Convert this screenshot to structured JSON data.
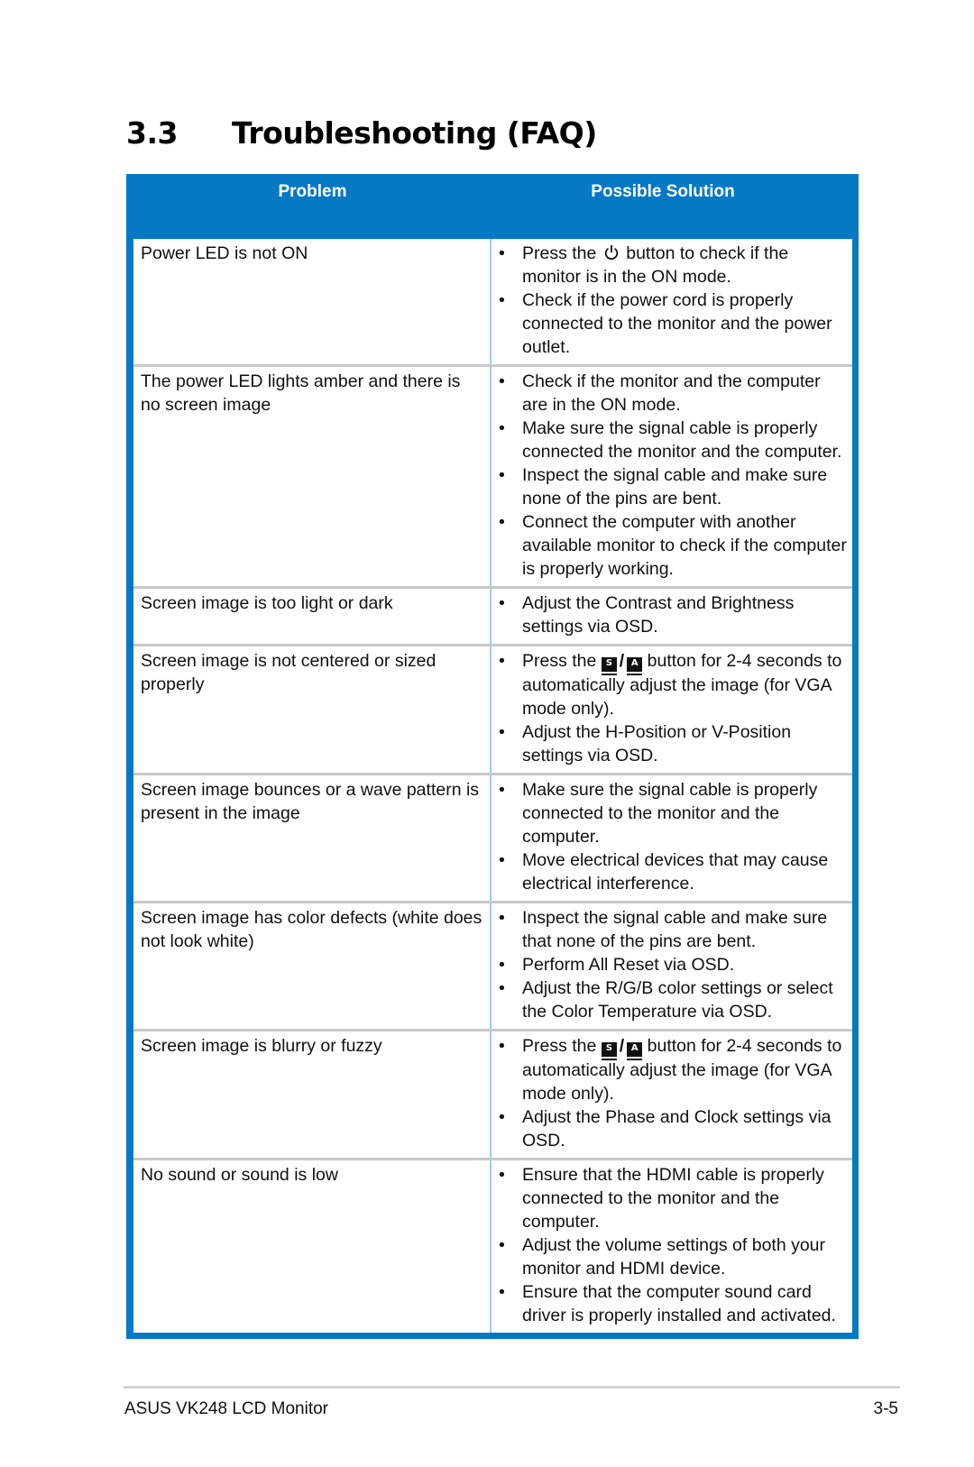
{
  "page": {
    "section_number": "3.3",
    "title": "Troubleshooting (FAQ)",
    "table": {
      "headers": {
        "problem": "Problem",
        "solution": "Possible Solution"
      },
      "header_color": "#0779c4",
      "rows": [
        {
          "problem": "Power  LED is not ON",
          "solutions": [
            {
              "before": "Press the",
              "icon": "power-icon",
              "after": "button to check if the monitor is in the ON mode."
            },
            {
              "before": "Check if the power cord is properly connected to the monitor and the power outlet."
            }
          ]
        },
        {
          "problem": "The power LED lights amber and there is no screen image",
          "solutions": [
            {
              "before": "Check if the monitor and the computer are in the ON mode."
            },
            {
              "before": "Make sure the signal cable is properly connected the monitor and the computer."
            },
            {
              "before": "Inspect the signal cable and make sure none of the pins are bent."
            },
            {
              "before": "Connect the computer with another available monitor to check if the computer is properly working."
            }
          ]
        },
        {
          "problem": "Screen image is too light or dark",
          "solutions": [
            {
              "before": "Adjust the Contrast and Brightness settings via OSD."
            }
          ]
        },
        {
          "problem": "Screen image is not centered or sized properly",
          "solutions": [
            {
              "before": "Press the",
              "icon": "splendid-auto-key-icon",
              "key1": "S",
              "key_sep": "/",
              "key2": "A",
              "after": "button for 2-4 seconds to automatically adjust the image (for VGA mode only)."
            },
            {
              "before": "Adjust the H-Position or V-Position settings via OSD."
            }
          ]
        },
        {
          "problem": "Screen image bounces or a wave pattern is present in the image",
          "solutions": [
            {
              "before": "Make sure the signal cable is properly connected to the monitor and the computer."
            },
            {
              "before": "Move electrical devices that may cause electrical interference."
            }
          ]
        },
        {
          "problem": "Screen image has color defects (white does not look white)",
          "solutions": [
            {
              "before": "Inspect the signal cable and make sure that none of the pins are bent."
            },
            {
              "before": "Perform All Reset via OSD."
            },
            {
              "before": "Adjust the R/G/B color settings or select the Color Temperature via OSD."
            }
          ]
        },
        {
          "problem": "Screen image is blurry or fuzzy",
          "solutions": [
            {
              "before": "Press the",
              "icon": "splendid-auto-key-icon",
              "key1": "S",
              "key_sep": "/",
              "key2": "A",
              "after": "button for 2-4 seconds to automatically adjust the image (for VGA mode only)."
            },
            {
              "before": "Adjust the Phase and Clock settings via OSD."
            }
          ]
        },
        {
          "problem": "No sound or sound is low",
          "solutions": [
            {
              "before": "Ensure that the HDMI cable is properly connected to the monitor and the computer."
            },
            {
              "before": "Adjust the volume settings of both your monitor and HDMI device."
            },
            {
              "before": "Ensure that the computer sound card driver is properly installed and activated."
            }
          ]
        }
      ]
    }
  },
  "footer": {
    "product": "ASUS VK248 LCD Monitor",
    "page_number": "3-5"
  },
  "bullet": "•"
}
